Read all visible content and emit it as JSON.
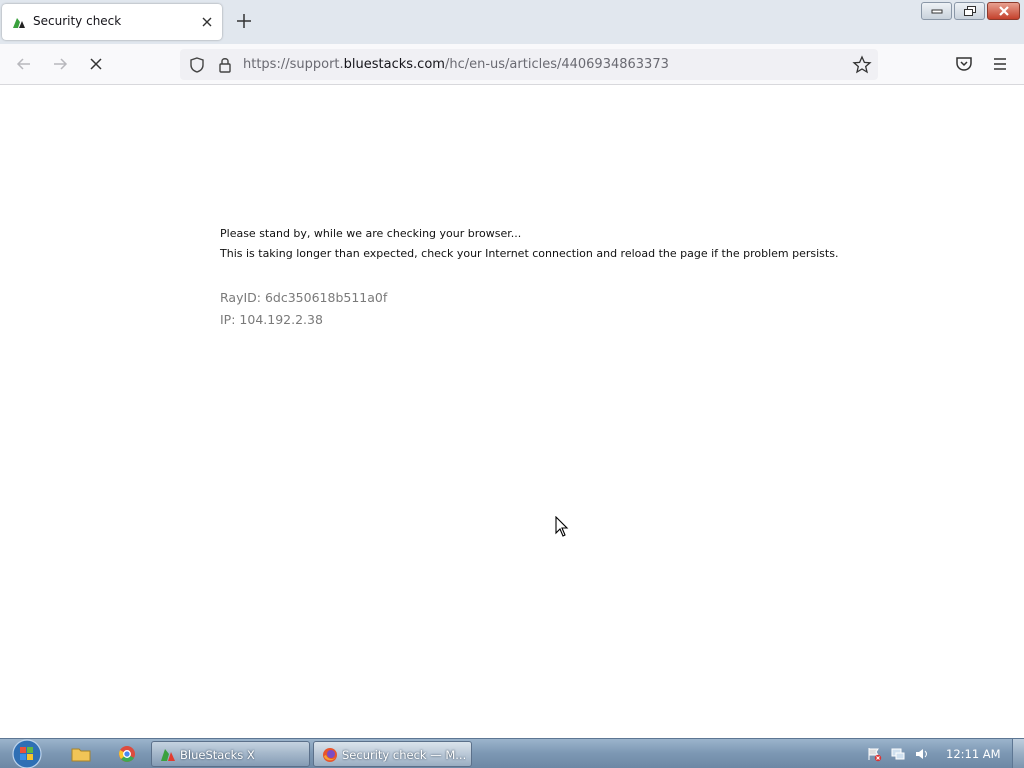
{
  "browser": {
    "tab": {
      "title": "Security check",
      "favicon": "bluestacks-favicon-icon"
    },
    "url": {
      "prefix": "https://support.",
      "domain": "bluestacks.com",
      "path": "/hc/en-us/articles/4406934863373"
    }
  },
  "page": {
    "line1": "Please stand by, while we are checking your browser...",
    "line2": "This is taking longer than expected, check your Internet connection and reload the page if the problem persists.",
    "ray_id": "RayID: 6dc350618b511a0f",
    "ip": "IP: 104.192.2.38"
  },
  "taskbar": {
    "tasks": [
      {
        "label": "BlueStacks X",
        "icon": "bluestacks-icon"
      },
      {
        "label": "Security check — M...",
        "icon": "firefox-icon"
      }
    ],
    "clock": "12:11 AM"
  },
  "colors": {
    "tabstrip": "#e1e7ee",
    "taskbar": "#7c97b3",
    "page_bg": "#ffffff"
  }
}
